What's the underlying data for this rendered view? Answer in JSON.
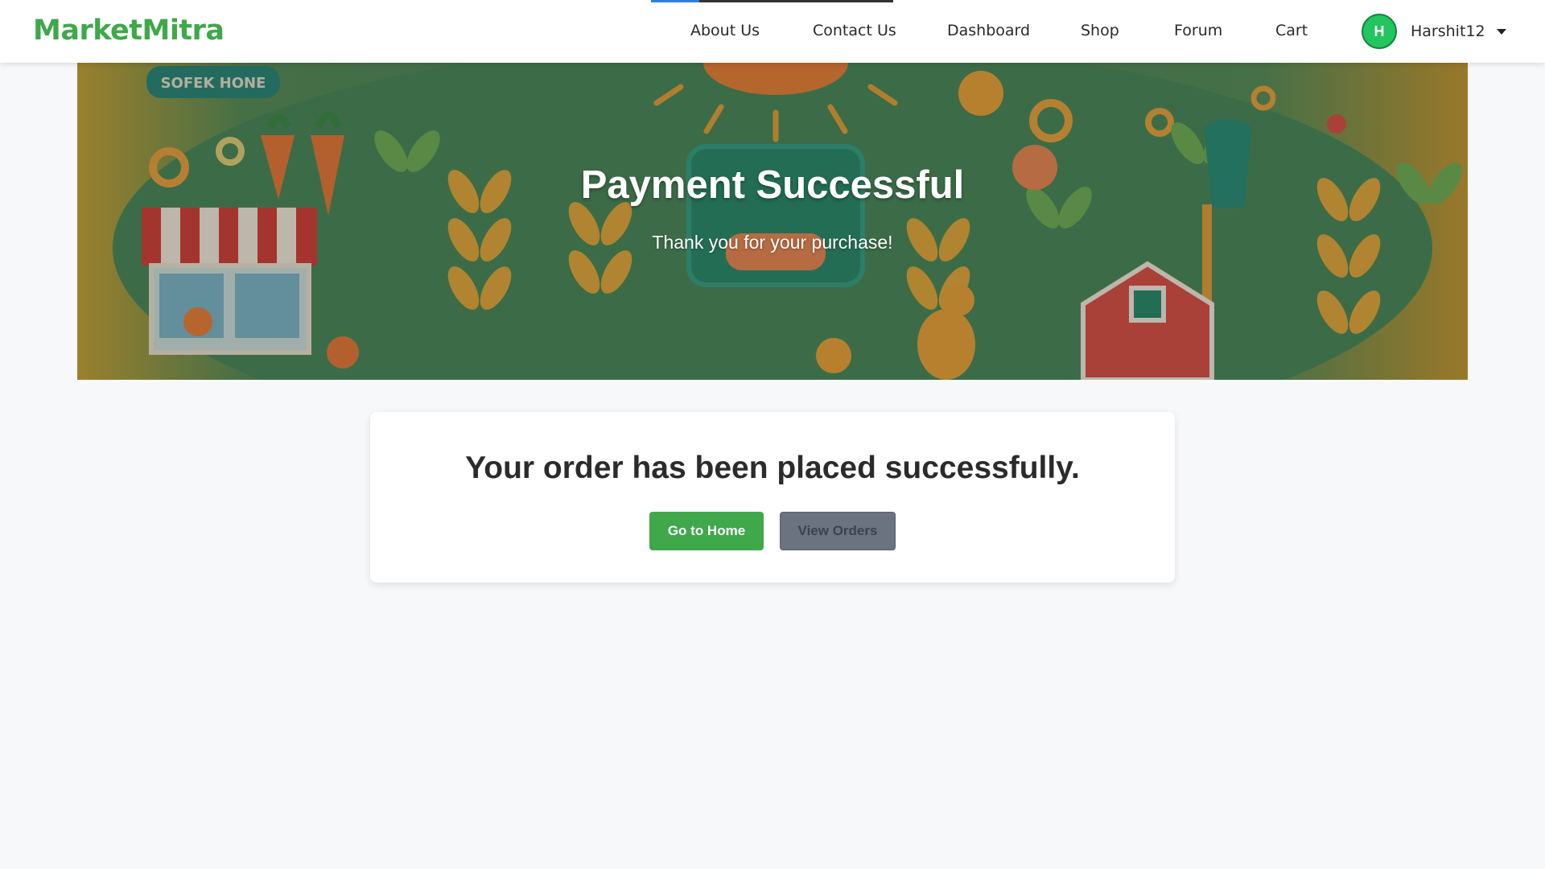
{
  "nav": {
    "brand": "MarketMitra",
    "links": [
      "About Us",
      "Contact Us",
      "Dashboard",
      "Shop",
      "Forum",
      "Cart"
    ],
    "user": {
      "initial": "H",
      "name": "Harshit12"
    }
  },
  "hero": {
    "title": "Payment Successful",
    "subtitle": "Thank you for your purchase!",
    "sign_text": "SOFEK HONE"
  },
  "confirmation": {
    "message": "Your order has been placed successfully.",
    "home_button": "Go to Home",
    "orders_button": "View Orders"
  },
  "colors": {
    "brand_green": "#3fa84a",
    "avatar_green": "#22c55e",
    "secondary_button": "#6b7380",
    "page_bg": "#f7f8fa"
  }
}
